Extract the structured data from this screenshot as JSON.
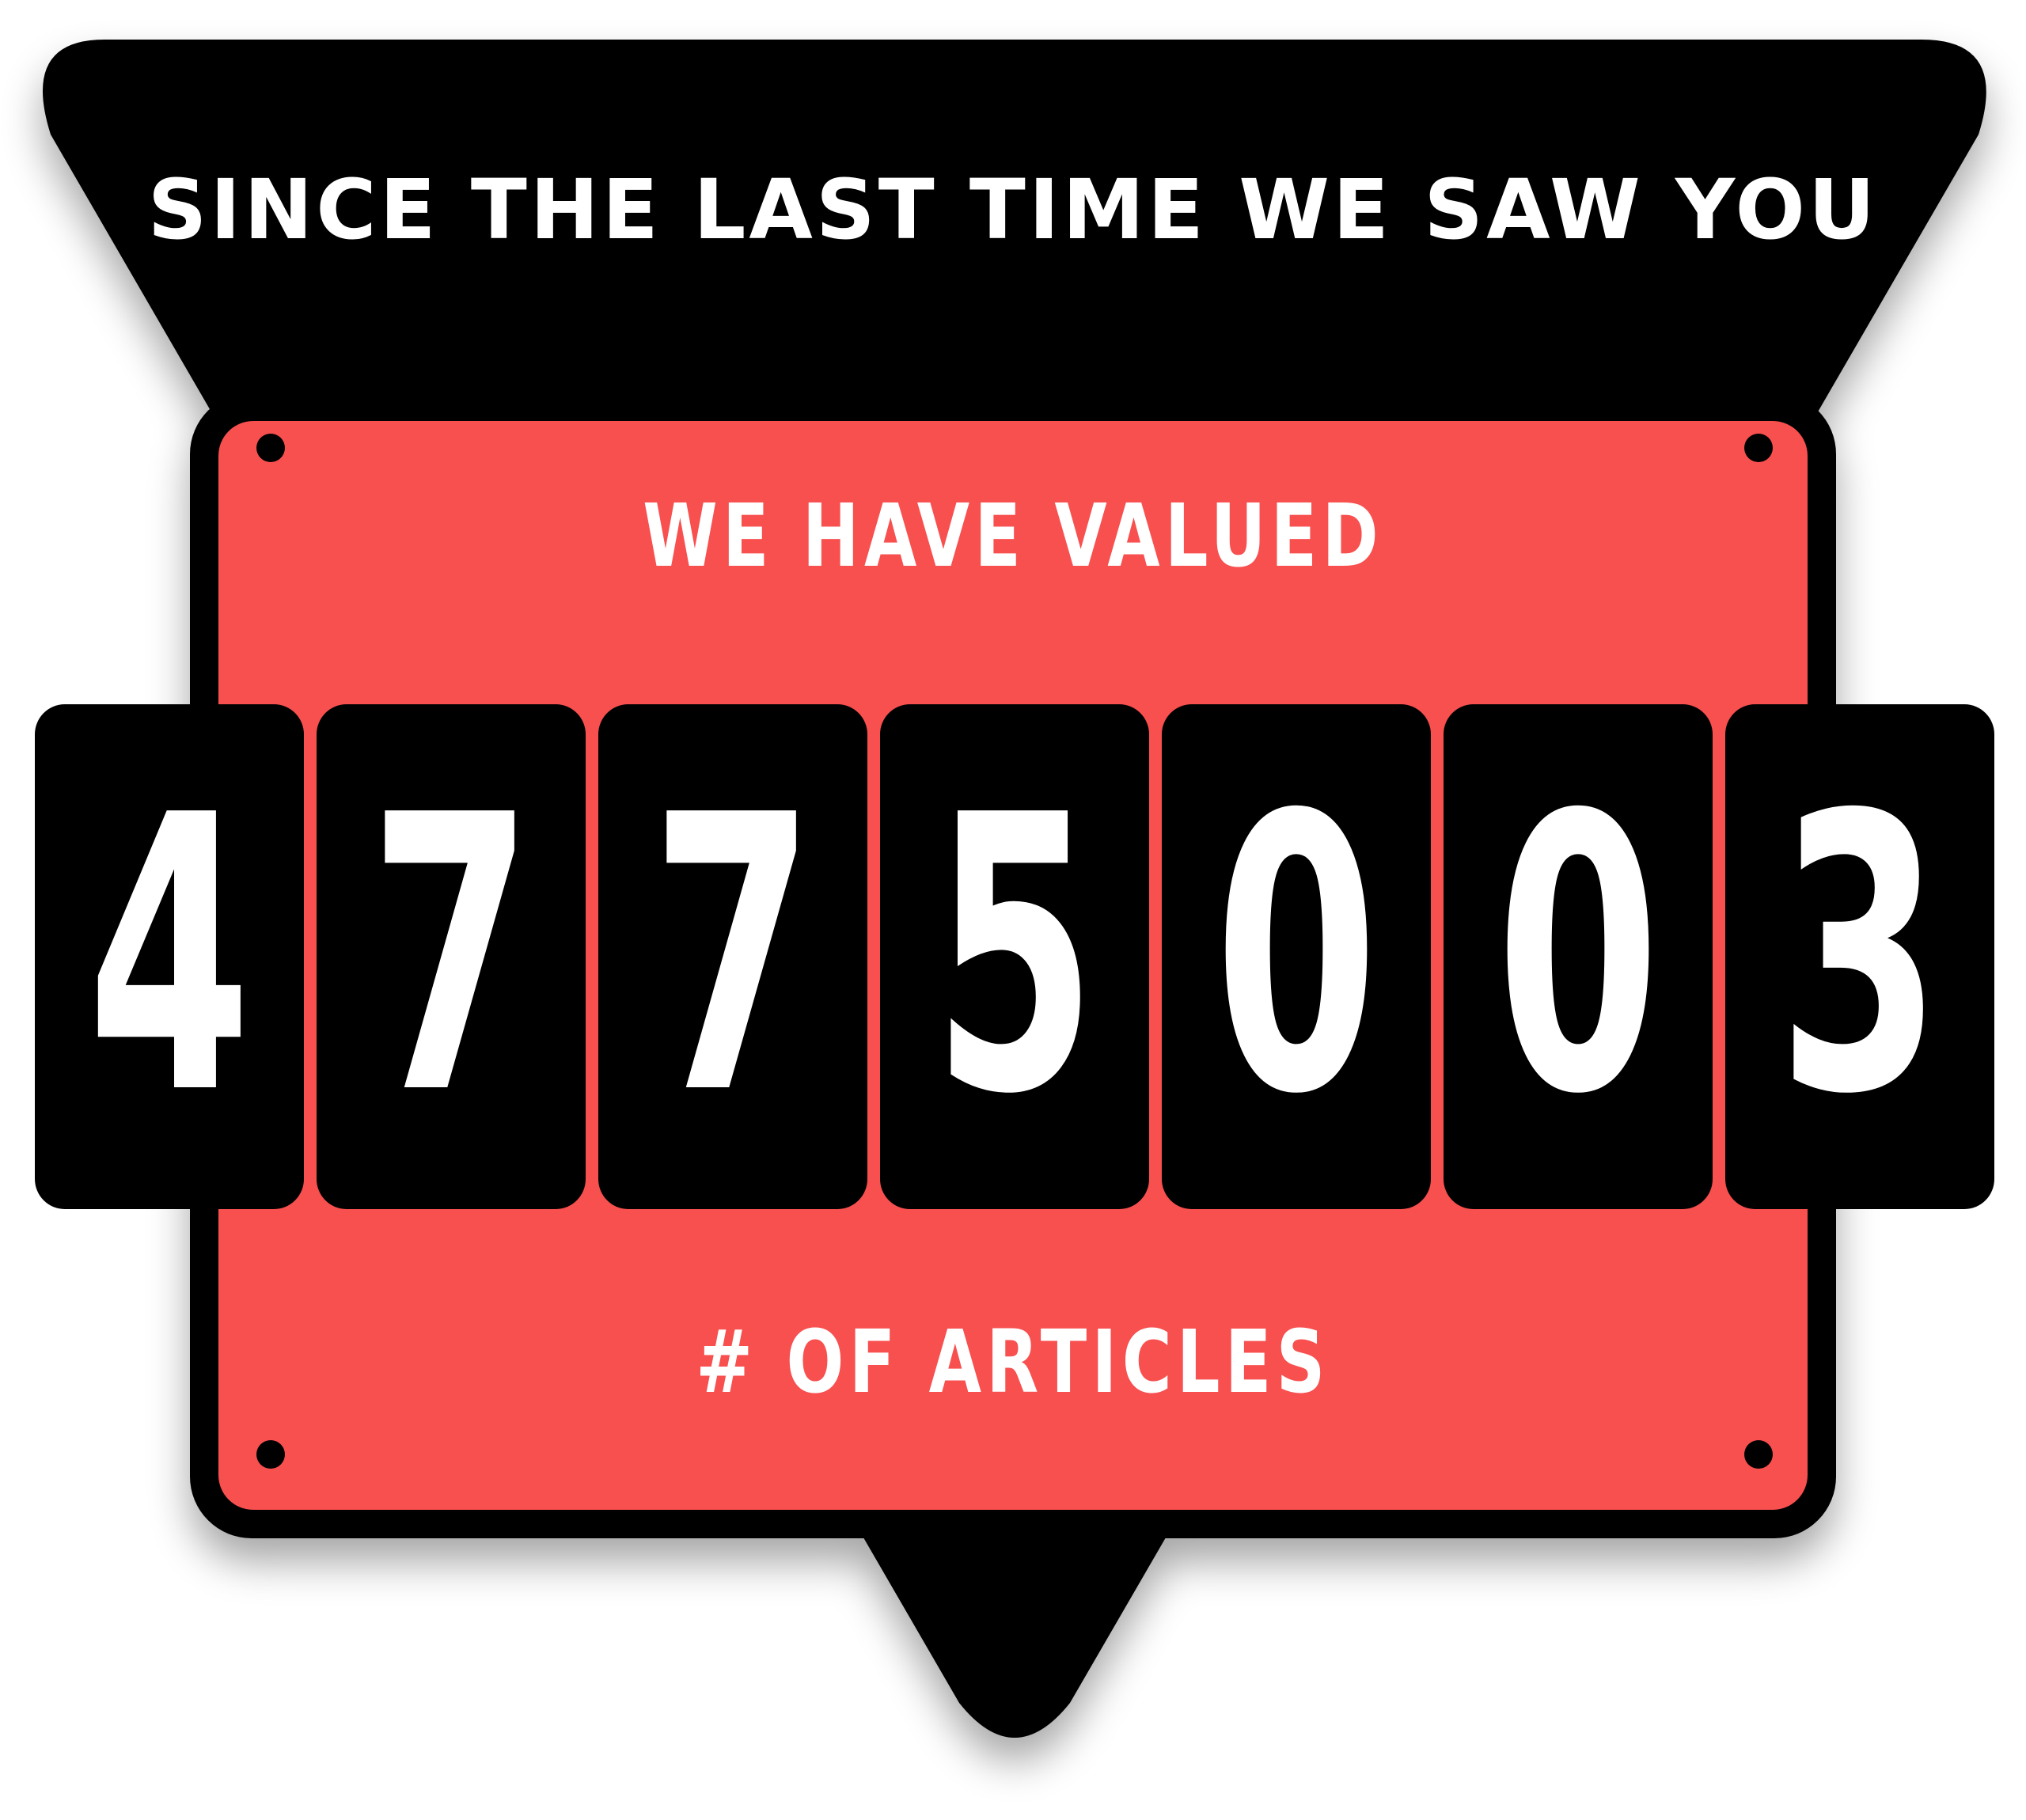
{
  "headline": "SINCE THE LAST TIME WE SAW YOU",
  "label_top": "WE HAVE VALUED",
  "counter": {
    "digits": [
      "4",
      "7",
      "7",
      "5",
      "0",
      "0",
      "3"
    ]
  },
  "label_bottom": "# OF ARTICLES",
  "colors": {
    "panel": "#f84f4f",
    "frame": "#000000",
    "text": "#ffffff",
    "background": "#ffffff"
  }
}
